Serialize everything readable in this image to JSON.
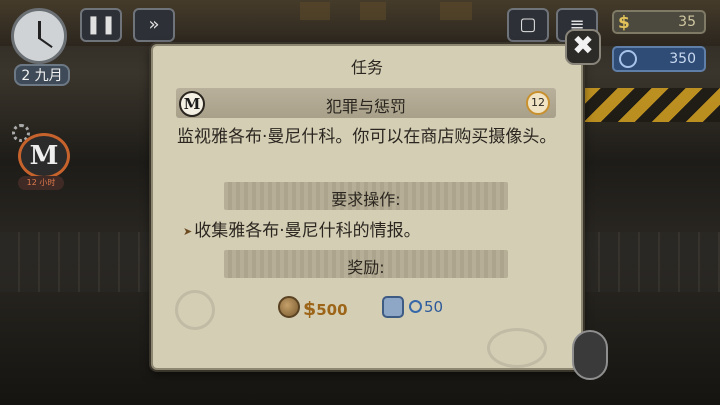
{
  "hud": {
    "date": "2 九月",
    "pause_icon": "pause-icon",
    "fast_forward_icon": "fast-forward-icon",
    "money": "35",
    "money_symbol": "$",
    "tokens": "350",
    "side_badge_letter": "M",
    "side_hours": "12 小时"
  },
  "dialog": {
    "title": "任务",
    "close_label": "✖",
    "mission": {
      "badge_letter": "M",
      "name": "犯罪与惩罚",
      "level": "12"
    },
    "description": "监视雅各布·曼尼什科。你可以在商店购买摄像头。",
    "requirements_header": "要求操作:",
    "requirements": [
      "收集雅各布·曼尼什科的情报。"
    ],
    "rewards_header": "奖励:",
    "rewards": {
      "money_symbol": "$",
      "money": "500",
      "tokens": "50"
    }
  },
  "colors": {
    "dialog_bg": "#d4ceb5",
    "money_text": "#9c6518",
    "token_text": "#2d5a9a",
    "hazard": "#d4a020"
  }
}
